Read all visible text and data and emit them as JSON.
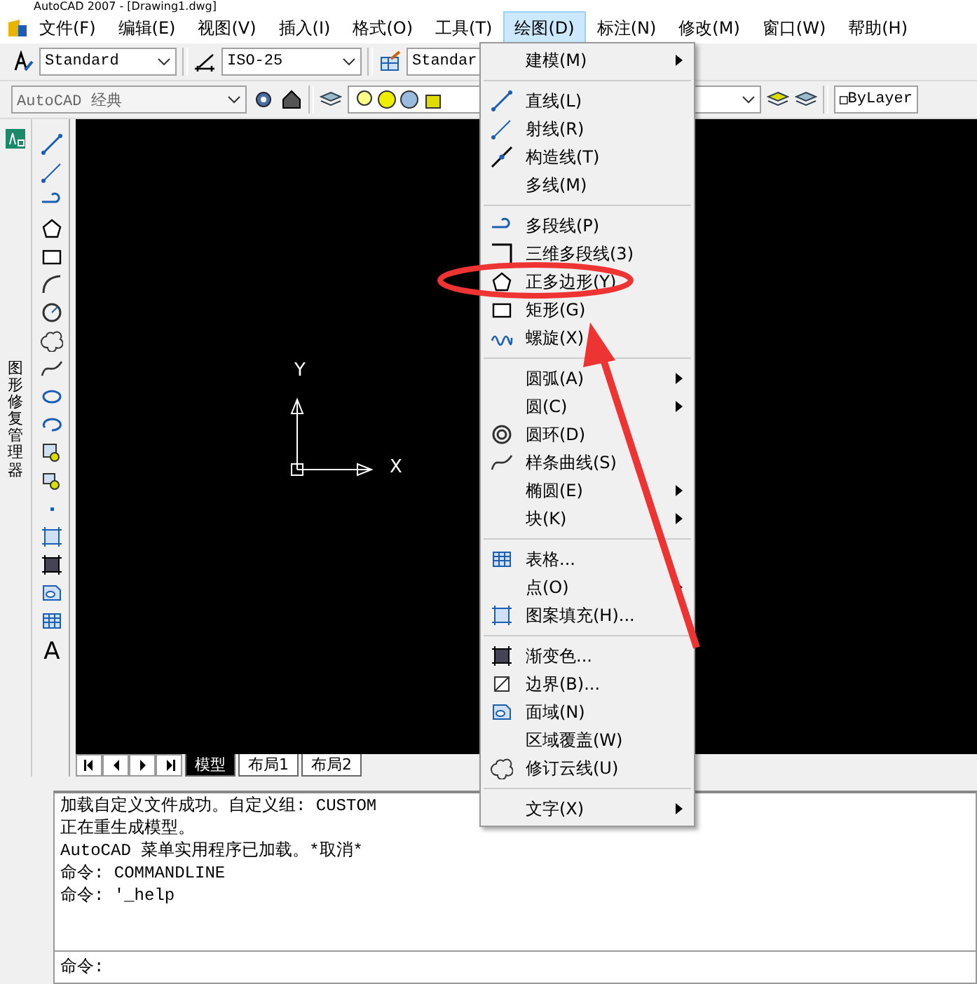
{
  "window": {
    "title": "AutoCAD 2007 - [Drawing1.dwg]"
  },
  "menu_bar": [
    {
      "label": "文件(F)",
      "selected": false
    },
    {
      "label": "编辑(E)",
      "selected": false
    },
    {
      "label": "视图(V)",
      "selected": false
    },
    {
      "label": "插入(I)",
      "selected": false
    },
    {
      "label": "格式(O)",
      "selected": false
    },
    {
      "label": "工具(T)",
      "selected": false
    },
    {
      "label": "绘图(D)",
      "selected": true
    },
    {
      "label": "标注(N)",
      "selected": false
    },
    {
      "label": "修改(M)",
      "selected": false
    },
    {
      "label": "窗口(W)",
      "selected": false
    },
    {
      "label": "帮助(H)",
      "selected": false
    }
  ],
  "styles_toolbar": {
    "text_style": "Standard",
    "dim_style": "ISO-25",
    "table_style": "Standar"
  },
  "workspace_toolbar": {
    "workspace": "AutoCAD 经典",
    "linetype": "ByLayer"
  },
  "side_palette": {
    "title": "图形修复管理器"
  },
  "draw_toolbar": {
    "text_tool": "A"
  },
  "canvas": {
    "y_axis": "Y",
    "x_axis": "X"
  },
  "layout_tabs": [
    {
      "label": "模型",
      "selected": true
    },
    {
      "label": "布局1",
      "selected": false
    },
    {
      "label": "布局2",
      "selected": false
    }
  ],
  "command_history": [
    "加载自定义文件成功。自定义组: CUSTOM",
    "正在重生成模型。",
    "AutoCAD 菜单实用程序已加载。*取消*",
    "命令: COMMANDLINE",
    "命令: '_help"
  ],
  "command_prompt": "命令:",
  "draw_menu": [
    {
      "kind": "item",
      "label": "建模(M)",
      "submenu": true
    },
    {
      "kind": "separator"
    },
    {
      "kind": "item",
      "label": "直线(L)",
      "submenu": false
    },
    {
      "kind": "item",
      "label": "射线(R)",
      "submenu": false
    },
    {
      "kind": "item",
      "label": "构造线(T)",
      "submenu": false
    },
    {
      "kind": "item",
      "label": "多线(M)",
      "submenu": false
    },
    {
      "kind": "separator"
    },
    {
      "kind": "item",
      "label": "多段线(P)",
      "submenu": false
    },
    {
      "kind": "item",
      "label": "三维多段线(3)",
      "submenu": false
    },
    {
      "kind": "item",
      "label": "正多边形(Y)",
      "submenu": false
    },
    {
      "kind": "item",
      "label": "矩形(G)",
      "submenu": false
    },
    {
      "kind": "item",
      "label": "螺旋(X)",
      "submenu": false
    },
    {
      "kind": "separator"
    },
    {
      "kind": "item",
      "label": "圆弧(A)",
      "submenu": true
    },
    {
      "kind": "item",
      "label": "圆(C)",
      "submenu": true
    },
    {
      "kind": "item",
      "label": "圆环(D)",
      "submenu": false
    },
    {
      "kind": "item",
      "label": "样条曲线(S)",
      "submenu": false
    },
    {
      "kind": "item",
      "label": "椭圆(E)",
      "submenu": true
    },
    {
      "kind": "item",
      "label": "块(K)",
      "submenu": true
    },
    {
      "kind": "separator"
    },
    {
      "kind": "item",
      "label": "表格...",
      "submenu": false
    },
    {
      "kind": "item",
      "label": "点(O)",
      "submenu": true
    },
    {
      "kind": "item",
      "label": "图案填充(H)...",
      "submenu": false
    },
    {
      "kind": "separator"
    },
    {
      "kind": "item",
      "label": "渐变色...",
      "submenu": false
    },
    {
      "kind": "item",
      "label": "边界(B)...",
      "submenu": false
    },
    {
      "kind": "item",
      "label": "面域(N)",
      "submenu": false
    },
    {
      "kind": "item",
      "label": "区域覆盖(W)",
      "submenu": false
    },
    {
      "kind": "item",
      "label": "修订云线(U)",
      "submenu": false
    },
    {
      "kind": "separator"
    },
    {
      "kind": "item",
      "label": "文字(X)",
      "submenu": true
    }
  ]
}
